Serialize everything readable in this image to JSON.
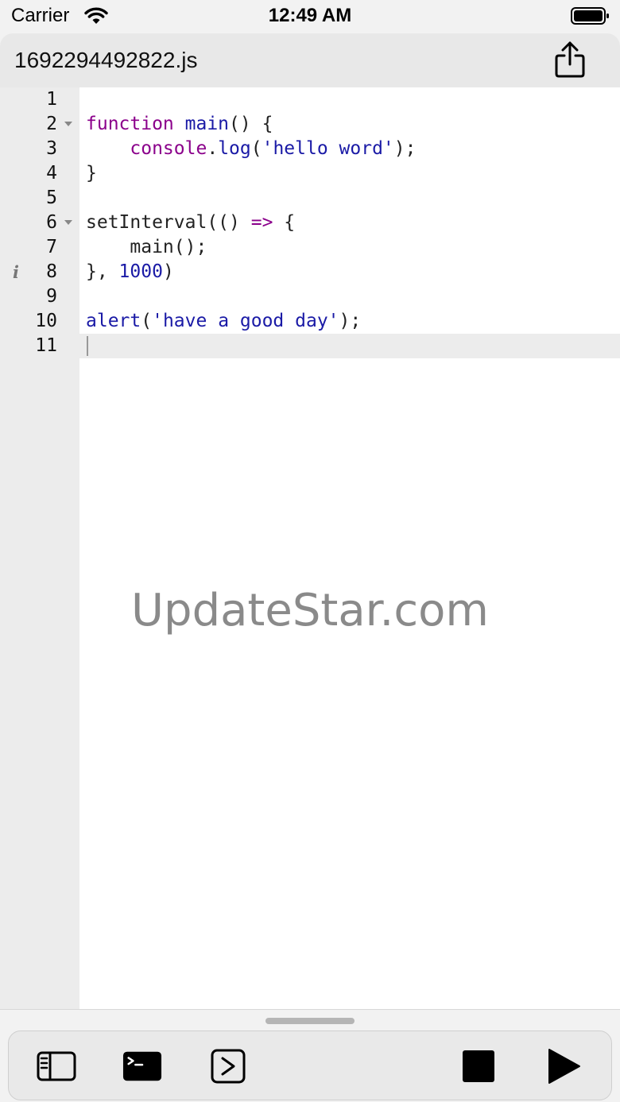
{
  "status_bar": {
    "carrier": "Carrier",
    "time": "12:49 AM"
  },
  "header": {
    "title": "1692294492822.js",
    "share_icon": "share-icon"
  },
  "editor": {
    "line_numbers": [
      "1",
      "2",
      "3",
      "4",
      "5",
      "6",
      "7",
      "8",
      "9",
      "10",
      "11"
    ],
    "active_line": "11",
    "info_marker": "i",
    "info_line": "8",
    "folded_lines": [
      "2",
      "6"
    ],
    "lines": [
      "",
      "function main() {",
      "    console.log('hello word');",
      "}",
      "",
      "setInterval(() => {",
      "    main();",
      "}, 1000)",
      "",
      "alert('have a good day');",
      ""
    ]
  },
  "watermark": "UpdateStar.com",
  "toolbar": {
    "buttons": [
      "sidebar-icon",
      "terminal-icon",
      "console-icon",
      "stop-icon",
      "play-icon"
    ]
  },
  "colors": {
    "keyword": "#8b008b",
    "string": "#1a1aa6",
    "number": "#1a1aa6",
    "gutter": "#ececec"
  }
}
